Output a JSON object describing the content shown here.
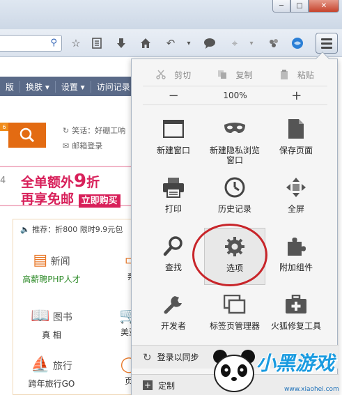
{
  "window": {
    "buttons": [
      "─",
      "□",
      "✕"
    ]
  },
  "toolbar": {
    "icons": [
      "bookmark-star-icon",
      "reading-list-icon",
      "download-icon",
      "home-icon",
      "undo-icon",
      "dropdown-icon",
      "chat-icon",
      "crop-icon",
      "dropdown-icon",
      "extension-icon",
      "globe-icon"
    ]
  },
  "bookmarks": {
    "items": [
      "版",
      "换肤 ▾",
      "设置 ▾",
      "访问记录"
    ]
  },
  "page": {
    "search_tag": "6",
    "login_lines": [
      "笑话：好硼工呐",
      "邮箱登录"
    ],
    "banner_num": "4",
    "banner_line1_a": "全单额外",
    "banner_line1_b": "9",
    "banner_line1_c": "折",
    "banner_line2_a": "再享免邮",
    "banner_line2_buy": "立即购买",
    "announcement": "推荐：折800 限时9.9元包",
    "categories": [
      {
        "name": "新闻",
        "sub": "高薪聘PHP人才",
        "sub_green": true
      },
      {
        "name": "图书",
        "sub": "真 相",
        "sub_green": false
      },
      {
        "name": "旅行",
        "sub": "跨年旅行GO",
        "sub_green": false
      }
    ],
    "right_subs": [
      "奔",
      "美亚",
      "页"
    ]
  },
  "menu": {
    "edit": {
      "cut": "剪切",
      "copy": "复制",
      "paste": "粘贴"
    },
    "zoom": {
      "minus": "−",
      "level": "100%",
      "plus": "+"
    },
    "tiles": [
      {
        "id": "new-window",
        "label": "新建窗口"
      },
      {
        "id": "private-window",
        "label": "新建隐私浏览\n窗口"
      },
      {
        "id": "save-page",
        "label": "保存页面"
      },
      {
        "id": "print",
        "label": "打印"
      },
      {
        "id": "history",
        "label": "历史记录"
      },
      {
        "id": "fullscreen",
        "label": "全屏"
      },
      {
        "id": "find",
        "label": "查找"
      },
      {
        "id": "options",
        "label": "选项"
      },
      {
        "id": "addons",
        "label": "附加组件"
      },
      {
        "id": "developer",
        "label": "开发者"
      },
      {
        "id": "tab-groups",
        "label": "标签页管理器"
      },
      {
        "id": "reset",
        "label": "火狐修复工具"
      }
    ],
    "sync_label": "登录以同步",
    "customize_label": "定制"
  },
  "watermark": {
    "text": "小黑游戏",
    "url": "www.xiaohei.com"
  }
}
